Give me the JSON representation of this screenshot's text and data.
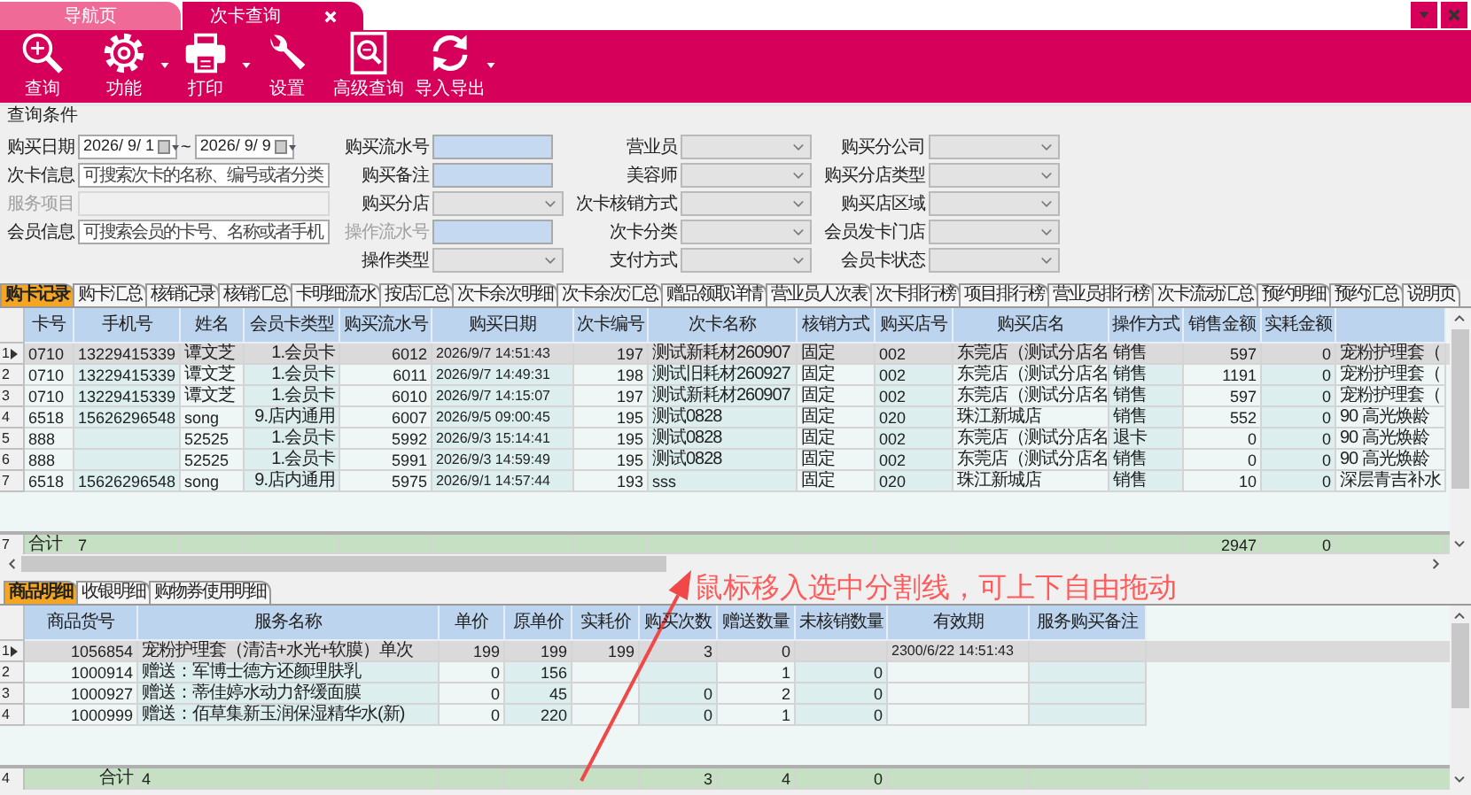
{
  "tabs": [
    {
      "label": "导航页",
      "selected": false,
      "closable": false
    },
    {
      "label": "次卡查询",
      "selected": true,
      "closable": true
    }
  ],
  "toolbar": [
    {
      "label": "查询",
      "dropdown": false
    },
    {
      "label": "功能",
      "dropdown": true
    },
    {
      "label": "打印",
      "dropdown": true
    },
    {
      "label": "设置",
      "dropdown": false
    },
    {
      "label": "高级查询",
      "dropdown": false
    },
    {
      "label": "导入导出",
      "dropdown": true
    }
  ],
  "query": {
    "title": "查询条件",
    "columns": [
      [
        {
          "kind": "date_range",
          "label": "购买日期",
          "from": "2026/ 9/ 1",
          "separator": "~",
          "to": "2026/ 9/ 9",
          "disabled": false
        },
        {
          "kind": "text",
          "label": "次卡信息",
          "placeholder": "可搜索次卡的名称、编号或者分类",
          "disabled": false
        },
        {
          "kind": "text",
          "label": "服务项目",
          "disabled": true
        },
        {
          "kind": "text",
          "label": "会员信息",
          "placeholder": "可搜索会员的卡号、名称或者手机",
          "disabled": false
        }
      ],
      [
        {
          "kind": "highlight",
          "label": "购买流水号",
          "disabled": false
        },
        {
          "kind": "highlight",
          "label": "购买备注",
          "disabled": false
        },
        {
          "kind": "select",
          "label": "购买分店",
          "disabled": false
        },
        {
          "kind": "highlight",
          "label": "操作流水号",
          "disabled": true
        },
        {
          "kind": "select",
          "label": "操作类型",
          "disabled": false
        }
      ],
      [
        {
          "kind": "select",
          "label": "营业员",
          "disabled": false
        },
        {
          "kind": "select",
          "label": "美容师",
          "disabled": false
        },
        {
          "kind": "select",
          "label": "次卡核销方式",
          "disabled": false
        },
        {
          "kind": "select",
          "label": "次卡分类",
          "disabled": false
        },
        {
          "kind": "select",
          "label": "支付方式",
          "disabled": false
        }
      ],
      [
        {
          "kind": "select",
          "label": "购买分公司",
          "disabled": false
        },
        {
          "kind": "select",
          "label": "购买分店类型",
          "disabled": false
        },
        {
          "kind": "select",
          "label": "购买店区域",
          "disabled": false
        },
        {
          "kind": "select",
          "label": "会员发卡门店",
          "disabled": false
        },
        {
          "kind": "select",
          "label": "会员卡状态",
          "disabled": false
        }
      ]
    ]
  },
  "report_tabs": [
    {
      "label": "购卡记录",
      "selected": true
    },
    {
      "label": "购卡汇总",
      "selected": false
    },
    {
      "label": "核销记录",
      "selected": false
    },
    {
      "label": "核销汇总",
      "selected": false
    },
    {
      "label": "卡明细流水",
      "selected": false
    },
    {
      "label": "按店汇总",
      "selected": false
    },
    {
      "label": "次卡余次明细",
      "selected": false
    },
    {
      "label": "次卡余次汇总",
      "selected": false
    },
    {
      "label": "赠品领取详情",
      "selected": false
    },
    {
      "label": "营业员人次表",
      "selected": false
    },
    {
      "label": "次卡排行榜",
      "selected": false
    },
    {
      "label": "项目排行榜",
      "selected": false
    },
    {
      "label": "营业员排行榜",
      "selected": false
    },
    {
      "label": "次卡流动汇总",
      "selected": false
    },
    {
      "label": "预约明细",
      "selected": false
    },
    {
      "label": "预约汇总",
      "selected": false
    },
    {
      "label": "说明页",
      "selected": false
    }
  ],
  "main_table": {
    "columns": [
      "卡号",
      "手机号",
      "姓名",
      "会员卡类型",
      "购买流水号",
      "购买日期",
      "次卡编号",
      "次卡名称",
      "核销方式",
      "购买店号",
      "购买店名",
      "操作方式",
      "销售金额",
      "实耗金额",
      null
    ],
    "rows": [
      {
        "number": "1",
        "selected": true,
        "cells": [
          "0710",
          "13229415339",
          "谭文芝",
          "1.会员卡",
          "6012",
          "2026/9/7 14:51:43",
          "197",
          "测试新耗材260907",
          "固定",
          "002",
          "东莞店（测试分店名",
          "销售",
          "597",
          "0",
          "宠粉护理套（"
        ]
      },
      {
        "number": "2",
        "selected": false,
        "cells": [
          "0710",
          "13229415339",
          "谭文芝",
          "1.会员卡",
          "6011",
          "2026/9/7 14:49:31",
          "198",
          "测试旧耗材260927",
          "固定",
          "002",
          "东莞店（测试分店名",
          "销售",
          "1191",
          "0",
          "宠粉护理套（"
        ]
      },
      {
        "number": "3",
        "selected": false,
        "cells": [
          "0710",
          "13229415339",
          "谭文芝",
          "1.会员卡",
          "6010",
          "2026/9/7 14:15:07",
          "197",
          "测试新耗材260907",
          "固定",
          "002",
          "东莞店（测试分店名",
          "销售",
          "597",
          "0",
          "宠粉护理套（"
        ]
      },
      {
        "number": "4",
        "selected": false,
        "cells": [
          "6518",
          "15626296548",
          "song",
          "9.店内通用",
          "6007",
          "2026/9/5 09:00:45",
          "195",
          "测试0828",
          "固定",
          "020",
          "珠江新城店",
          "销售",
          "552",
          "0",
          "90 高光焕龄"
        ]
      },
      {
        "number": "5",
        "selected": false,
        "cells": [
          "888",
          null,
          "52525",
          "1.会员卡",
          "5992",
          "2026/9/3 15:14:41",
          "195",
          "测试0828",
          "固定",
          "002",
          "东莞店（测试分店名",
          "退卡",
          "0",
          "0",
          "90 高光焕龄"
        ]
      },
      {
        "number": "6",
        "selected": false,
        "cells": [
          "888",
          null,
          "52525",
          "1.会员卡",
          "5991",
          "2026/9/3 14:59:49",
          "195",
          "测试0828",
          "固定",
          "002",
          "东莞店（测试分店名",
          "销售",
          "0",
          "0",
          "90 高光焕龄"
        ]
      },
      {
        "number": "7",
        "selected": false,
        "cells": [
          "6518",
          "15626296548",
          "song",
          "9.店内通用",
          "5975",
          "2026/9/1 14:57:44",
          "193",
          "sss",
          "固定",
          "020",
          "珠江新城店",
          "销售",
          "10",
          "0",
          "深层青吉补水"
        ]
      }
    ],
    "total": {
      "number": "7",
      "cells": [
        "合计",
        "7",
        null,
        null,
        null,
        null,
        null,
        null,
        null,
        null,
        null,
        null,
        "2947",
        "0",
        null
      ]
    }
  },
  "annotation": {
    "text": "鼠标移入选中分割线，可上下自由拖动"
  },
  "detail_tabs": [
    {
      "label": "商品明细",
      "selected": true
    },
    {
      "label": "收银明细",
      "selected": false
    },
    {
      "label": "购物券使用明细",
      "selected": false
    }
  ],
  "detail_table": {
    "columns": [
      "商品货号",
      "服务名称",
      "单价",
      "原单价",
      "实耗价",
      "购买次数",
      "赠送数量",
      "未核销数量",
      "有效期",
      "服务购买备注"
    ],
    "rows": [
      {
        "number": "1",
        "selected": true,
        "cells": [
          "1056854",
          "宠粉护理套（清洁+水光+软膜）单次",
          "199",
          "199",
          "199",
          "3",
          "0",
          null,
          "2300/6/22 14:51:43",
          null
        ]
      },
      {
        "number": "2",
        "selected": false,
        "cells": [
          "1000914",
          "赠送：军博士德方还颜理肤乳",
          "0",
          "156",
          null,
          null,
          "1",
          "0",
          null,
          null
        ]
      },
      {
        "number": "3",
        "selected": false,
        "cells": [
          "1000927",
          "赠送：蒂佳婷水动力舒缓面膜",
          "0",
          "45",
          null,
          "0",
          "2",
          "0",
          null,
          null
        ]
      },
      {
        "number": "4",
        "selected": false,
        "cells": [
          "1000999",
          "赠送：佰草集新玉润保湿精华水(新)",
          "0",
          "220",
          null,
          "0",
          "1",
          "0",
          null,
          null
        ]
      }
    ],
    "total": {
      "number": "4",
      "cells": [
        "合计",
        "4",
        null,
        null,
        null,
        "3",
        "4",
        "0",
        null,
        null
      ]
    }
  }
}
